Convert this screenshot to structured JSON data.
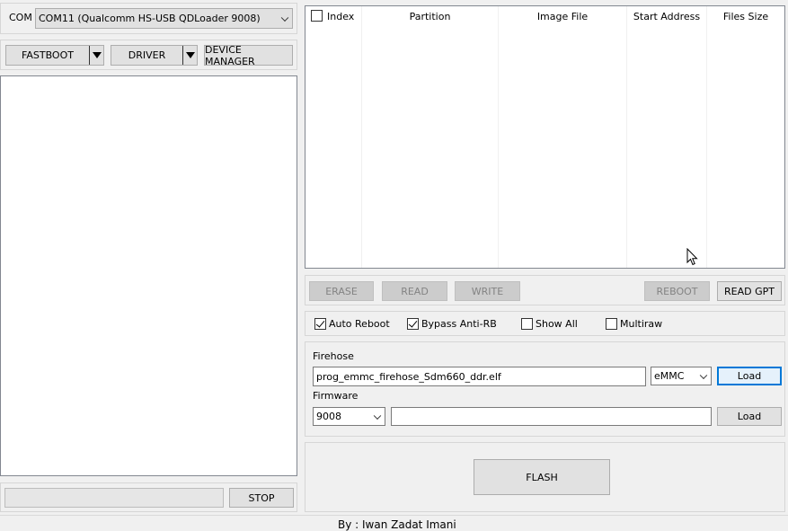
{
  "left": {
    "com_label": "COM",
    "com_port": "COM11 (Qualcomm HS-USB QDLoader 9008)",
    "fastboot": "FASTBOOT",
    "driver": "DRIVER",
    "device_manager": "DEVICE MANAGER",
    "stop": "STOP"
  },
  "table": {
    "columns": [
      "Index",
      "Partition",
      "Image File",
      "Start Address",
      "Files Size"
    ]
  },
  "actions": {
    "erase": "ERASE",
    "read": "READ",
    "write": "WRITE",
    "reboot": "REBOOT",
    "read_gpt": "READ GPT"
  },
  "options": {
    "auto_reboot": {
      "label": "Auto Reboot",
      "checked": true
    },
    "bypass_anti_rb": {
      "label": "Bypass Anti-RB",
      "checked": true
    },
    "show_all": {
      "label": "Show All",
      "checked": false
    },
    "multiraw": {
      "label": "Multiraw",
      "checked": false
    }
  },
  "firehose": {
    "label": "Firehose",
    "file": "prog_emmc_firehose_Sdm660_ddr.elf",
    "storage": "eMMC",
    "load": "Load"
  },
  "firmware": {
    "label": "Firmware",
    "mode": "9008",
    "path": "",
    "load": "Load"
  },
  "flash": "FLASH",
  "footer": "By : Iwan Zadat Imani"
}
